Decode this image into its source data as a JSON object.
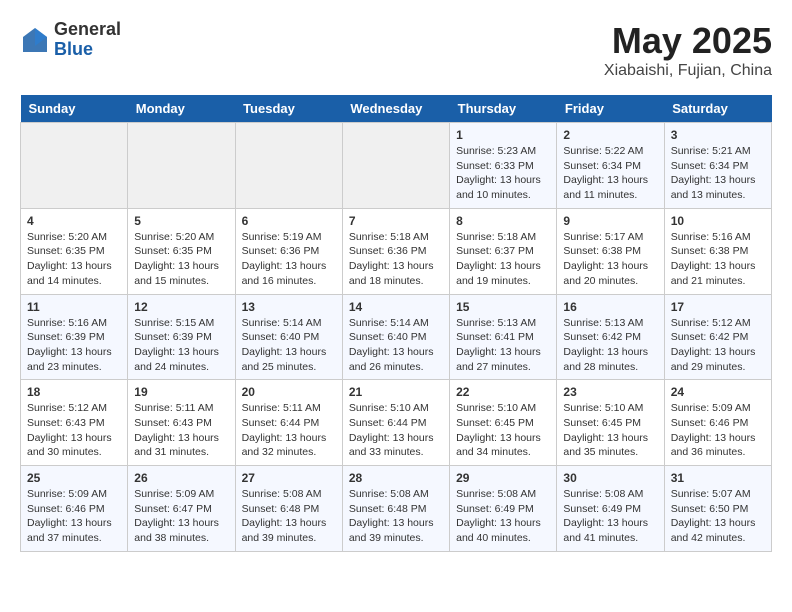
{
  "header": {
    "logo_general": "General",
    "logo_blue": "Blue",
    "month_title": "May 2025",
    "subtitle": "Xiabaishi, Fujian, China"
  },
  "weekdays": [
    "Sunday",
    "Monday",
    "Tuesday",
    "Wednesday",
    "Thursday",
    "Friday",
    "Saturday"
  ],
  "weeks": [
    [
      {
        "day": "",
        "info": ""
      },
      {
        "day": "",
        "info": ""
      },
      {
        "day": "",
        "info": ""
      },
      {
        "day": "",
        "info": ""
      },
      {
        "day": "1",
        "info": "Sunrise: 5:23 AM\nSunset: 6:33 PM\nDaylight: 13 hours\nand 10 minutes."
      },
      {
        "day": "2",
        "info": "Sunrise: 5:22 AM\nSunset: 6:34 PM\nDaylight: 13 hours\nand 11 minutes."
      },
      {
        "day": "3",
        "info": "Sunrise: 5:21 AM\nSunset: 6:34 PM\nDaylight: 13 hours\nand 13 minutes."
      }
    ],
    [
      {
        "day": "4",
        "info": "Sunrise: 5:20 AM\nSunset: 6:35 PM\nDaylight: 13 hours\nand 14 minutes."
      },
      {
        "day": "5",
        "info": "Sunrise: 5:20 AM\nSunset: 6:35 PM\nDaylight: 13 hours\nand 15 minutes."
      },
      {
        "day": "6",
        "info": "Sunrise: 5:19 AM\nSunset: 6:36 PM\nDaylight: 13 hours\nand 16 minutes."
      },
      {
        "day": "7",
        "info": "Sunrise: 5:18 AM\nSunset: 6:36 PM\nDaylight: 13 hours\nand 18 minutes."
      },
      {
        "day": "8",
        "info": "Sunrise: 5:18 AM\nSunset: 6:37 PM\nDaylight: 13 hours\nand 19 minutes."
      },
      {
        "day": "9",
        "info": "Sunrise: 5:17 AM\nSunset: 6:38 PM\nDaylight: 13 hours\nand 20 minutes."
      },
      {
        "day": "10",
        "info": "Sunrise: 5:16 AM\nSunset: 6:38 PM\nDaylight: 13 hours\nand 21 minutes."
      }
    ],
    [
      {
        "day": "11",
        "info": "Sunrise: 5:16 AM\nSunset: 6:39 PM\nDaylight: 13 hours\nand 23 minutes."
      },
      {
        "day": "12",
        "info": "Sunrise: 5:15 AM\nSunset: 6:39 PM\nDaylight: 13 hours\nand 24 minutes."
      },
      {
        "day": "13",
        "info": "Sunrise: 5:14 AM\nSunset: 6:40 PM\nDaylight: 13 hours\nand 25 minutes."
      },
      {
        "day": "14",
        "info": "Sunrise: 5:14 AM\nSunset: 6:40 PM\nDaylight: 13 hours\nand 26 minutes."
      },
      {
        "day": "15",
        "info": "Sunrise: 5:13 AM\nSunset: 6:41 PM\nDaylight: 13 hours\nand 27 minutes."
      },
      {
        "day": "16",
        "info": "Sunrise: 5:13 AM\nSunset: 6:42 PM\nDaylight: 13 hours\nand 28 minutes."
      },
      {
        "day": "17",
        "info": "Sunrise: 5:12 AM\nSunset: 6:42 PM\nDaylight: 13 hours\nand 29 minutes."
      }
    ],
    [
      {
        "day": "18",
        "info": "Sunrise: 5:12 AM\nSunset: 6:43 PM\nDaylight: 13 hours\nand 30 minutes."
      },
      {
        "day": "19",
        "info": "Sunrise: 5:11 AM\nSunset: 6:43 PM\nDaylight: 13 hours\nand 31 minutes."
      },
      {
        "day": "20",
        "info": "Sunrise: 5:11 AM\nSunset: 6:44 PM\nDaylight: 13 hours\nand 32 minutes."
      },
      {
        "day": "21",
        "info": "Sunrise: 5:10 AM\nSunset: 6:44 PM\nDaylight: 13 hours\nand 33 minutes."
      },
      {
        "day": "22",
        "info": "Sunrise: 5:10 AM\nSunset: 6:45 PM\nDaylight: 13 hours\nand 34 minutes."
      },
      {
        "day": "23",
        "info": "Sunrise: 5:10 AM\nSunset: 6:45 PM\nDaylight: 13 hours\nand 35 minutes."
      },
      {
        "day": "24",
        "info": "Sunrise: 5:09 AM\nSunset: 6:46 PM\nDaylight: 13 hours\nand 36 minutes."
      }
    ],
    [
      {
        "day": "25",
        "info": "Sunrise: 5:09 AM\nSunset: 6:46 PM\nDaylight: 13 hours\nand 37 minutes."
      },
      {
        "day": "26",
        "info": "Sunrise: 5:09 AM\nSunset: 6:47 PM\nDaylight: 13 hours\nand 38 minutes."
      },
      {
        "day": "27",
        "info": "Sunrise: 5:08 AM\nSunset: 6:48 PM\nDaylight: 13 hours\nand 39 minutes."
      },
      {
        "day": "28",
        "info": "Sunrise: 5:08 AM\nSunset: 6:48 PM\nDaylight: 13 hours\nand 39 minutes."
      },
      {
        "day": "29",
        "info": "Sunrise: 5:08 AM\nSunset: 6:49 PM\nDaylight: 13 hours\nand 40 minutes."
      },
      {
        "day": "30",
        "info": "Sunrise: 5:08 AM\nSunset: 6:49 PM\nDaylight: 13 hours\nand 41 minutes."
      },
      {
        "day": "31",
        "info": "Sunrise: 5:07 AM\nSunset: 6:50 PM\nDaylight: 13 hours\nand 42 minutes."
      }
    ]
  ]
}
